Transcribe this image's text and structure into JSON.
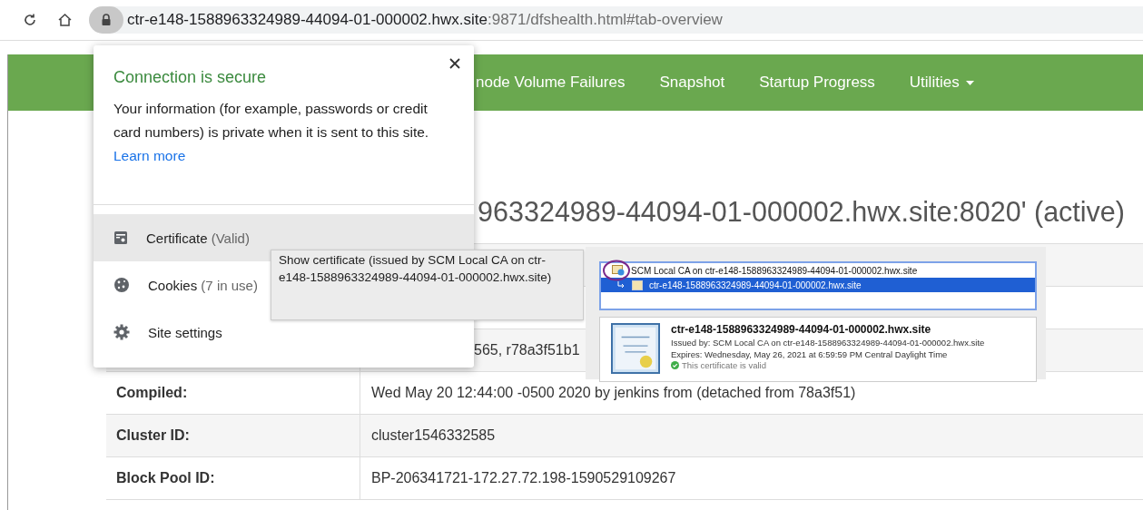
{
  "address_bar": {
    "host": "ctr-e148-1588963324989-44094-01-000002.hwx.site",
    "path": ":9871/dfshealth.html#tab-overview"
  },
  "nav": {
    "items": [
      {
        "label": "node Volume Failures",
        "dropdown": false
      },
      {
        "label": "Snapshot",
        "dropdown": false
      },
      {
        "label": "Startup Progress",
        "dropdown": false
      },
      {
        "label": "Utilities",
        "dropdown": true
      }
    ]
  },
  "heading": "963324989-44094-01-000002.hwx.site:8020' (active)",
  "table": {
    "rows": [
      {
        "kind": "covered"
      },
      {
        "kind": "covered"
      },
      {
        "kind": "covered",
        "fragment": "565, r78a3f51b1"
      },
      {
        "kind": "full",
        "label": "Compiled:",
        "value": "Wed May 20 12:44:00 -0500 2020 by jenkins from (detached from 78a3f51)"
      },
      {
        "kind": "full",
        "label": "Cluster ID:",
        "value": "cluster1546332585"
      },
      {
        "kind": "full",
        "label": "Block Pool ID:",
        "value": "BP-206341721-172.27.72.198-1590529109267"
      }
    ]
  },
  "popup": {
    "title": "Connection is secure",
    "body": "Your information (for example, passwords or credit card numbers) is private when it is sent to this site.",
    "link": "Learn more",
    "items": [
      {
        "kind": "certificate",
        "label": "Certificate",
        "detail": "(Valid)",
        "selected": true
      },
      {
        "kind": "cookies",
        "label": "Cookies",
        "detail": "(7 in use)",
        "selected": false
      },
      {
        "kind": "settings",
        "label": "Site settings",
        "selected": false
      }
    ]
  },
  "tooltip": "Show certificate (issued by SCM Local CA on ctr-e148-1588963324989-44094-01-000002.hwx.site)",
  "certificate_viewer": {
    "chain": [
      {
        "label": "SCM Local CA on ctr-e148-1588963324989-44094-01-000002.hwx.site",
        "selected": false,
        "children": [
          {
            "label": "ctr-e148-1588963324989-44094-01-000002.hwx.site",
            "selected": true
          }
        ]
      }
    ],
    "name": "ctr-e148-1588963324989-44094-01-000002.hwx.site",
    "issued_by": "Issued by: SCM Local CA on ctr-e148-1588963324989-44094-01-000002.hwx.site",
    "expires": "Expires: Wednesday, May 26, 2021 at 6:59:59 PM Central Daylight Time",
    "status": "This certificate is valid"
  }
}
